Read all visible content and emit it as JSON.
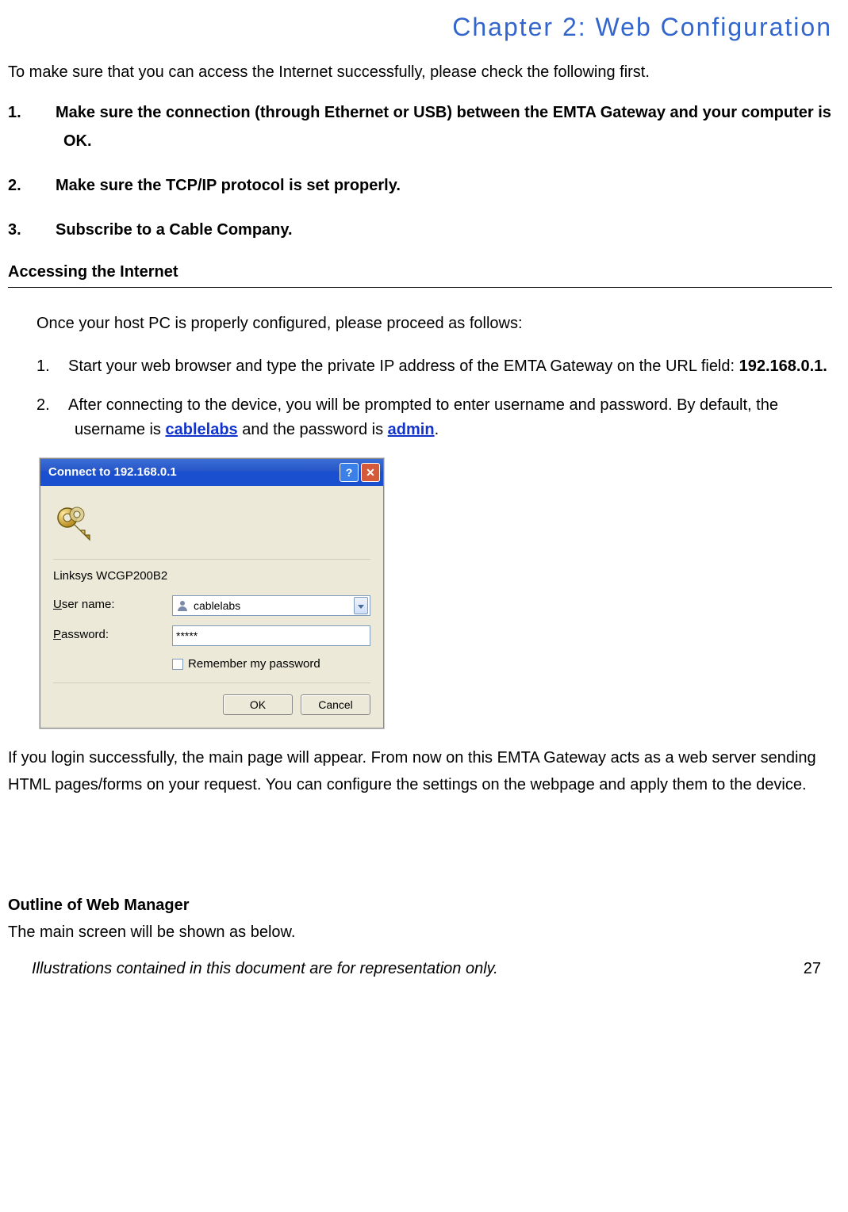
{
  "chapter_title": "Chapter 2: Web Configuration",
  "intro": "To make sure that you can access the Internet successfully, please check the following first.",
  "checklist": [
    {
      "num": "1.",
      "text": "Make sure the connection (through Ethernet or USB) between the EMTA Gateway and your computer is OK."
    },
    {
      "num": "2.",
      "text": "Make sure the TCP/IP protocol is set properly."
    },
    {
      "num": "3.",
      "text": "Subscribe to a Cable Company."
    }
  ],
  "section1_heading": "Accessing the Internet",
  "section1_intro": "Once your host PC is properly configured, please proceed as follows:",
  "steps": [
    {
      "num": "1.",
      "pre": "Start your web browser and type the private IP address of the EMTA Gateway on the URL field: ",
      "ip": "192.168.0.1."
    },
    {
      "num": "2.",
      "pre": "After connecting to the device, you will be prompted to enter username and password. By default, the username is ",
      "user": "cablelabs",
      "mid": " and the password is ",
      "pass": "admin",
      "post": "."
    }
  ],
  "dialog": {
    "title": "Connect to 192.168.0.1",
    "device": "Linksys WCGP200B2",
    "user_label_u": "U",
    "user_label_rest": "ser name:",
    "pass_label_u": "P",
    "pass_label_rest": "assword:",
    "user_value": "cablelabs",
    "pass_value": "*****",
    "remember_u": "R",
    "remember_rest": "emember my password",
    "ok": "OK",
    "cancel": "Cancel"
  },
  "after_dialog": "If you login successfully, the main page will appear. From now on this EMTA Gateway acts as a web server sending HTML pages/forms on your request. You can configure the settings on the webpage and apply them to the device.",
  "outline_heading": "Outline of Web Manager",
  "outline_sub": "The main screen will be shown as below.",
  "footer_text": "Illustrations contained in this document are for representation only.",
  "page_number": "27"
}
